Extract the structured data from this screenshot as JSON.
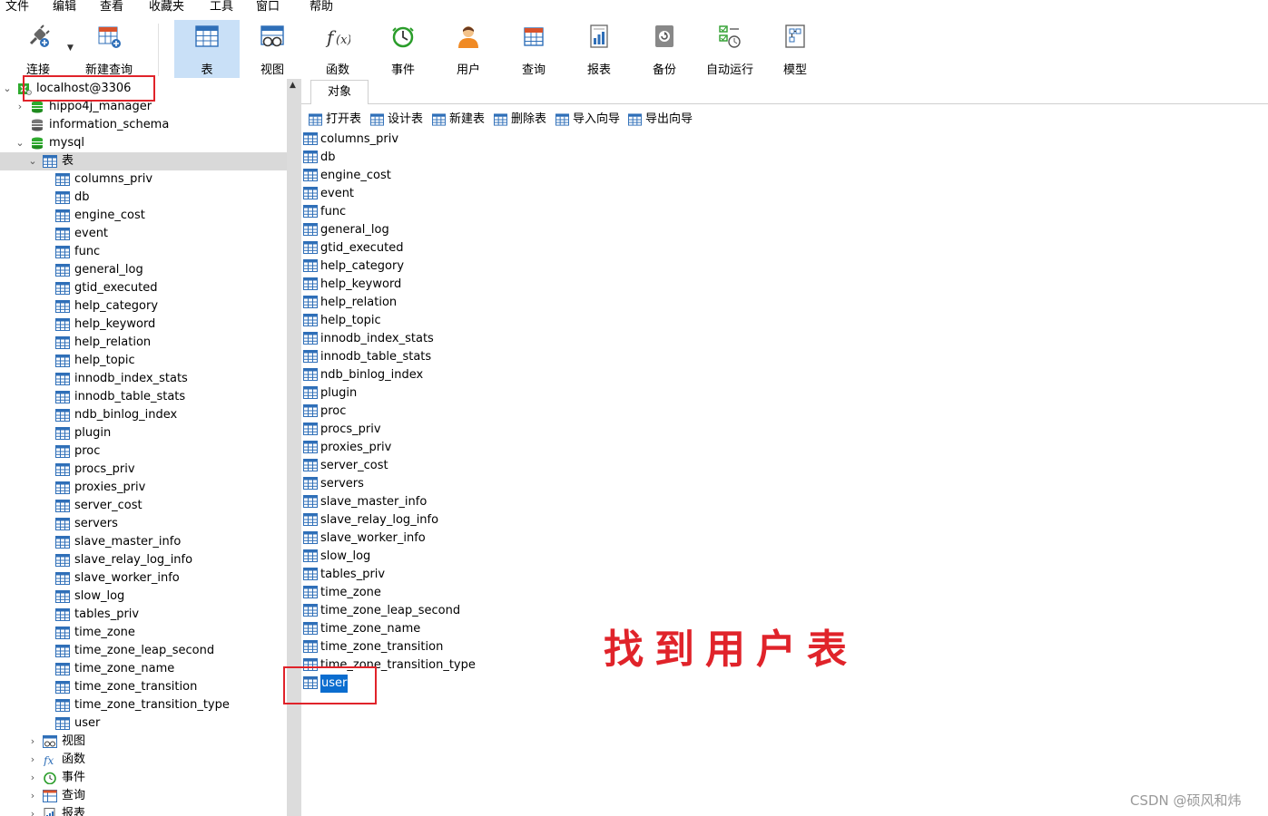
{
  "menu": [
    "文件",
    "编辑",
    "查看",
    "收藏夹",
    "工具",
    "窗口",
    "帮助"
  ],
  "toolbar": [
    {
      "label": "连接",
      "icon": "plug-icon"
    },
    {
      "label": "新建查询",
      "icon": "new-query-icon"
    },
    {
      "label": "表",
      "icon": "table-icon",
      "active": true
    },
    {
      "label": "视图",
      "icon": "view-icon"
    },
    {
      "label": "函数",
      "icon": "function-icon"
    },
    {
      "label": "事件",
      "icon": "clock-icon"
    },
    {
      "label": "用户",
      "icon": "user-icon"
    },
    {
      "label": "查询",
      "icon": "query-icon"
    },
    {
      "label": "报表",
      "icon": "report-icon"
    },
    {
      "label": "备份",
      "icon": "backup-icon"
    },
    {
      "label": "自动运行",
      "icon": "auto-run-icon"
    },
    {
      "label": "模型",
      "icon": "model-icon"
    }
  ],
  "tree": {
    "connection": "localhost@3306",
    "databases": [
      "hippo4j_manager",
      "information_schema",
      "mysql"
    ],
    "tables_node": "表",
    "tables": [
      "columns_priv",
      "db",
      "engine_cost",
      "event",
      "func",
      "general_log",
      "gtid_executed",
      "help_category",
      "help_keyword",
      "help_relation",
      "help_topic",
      "innodb_index_stats",
      "innodb_table_stats",
      "ndb_binlog_index",
      "plugin",
      "proc",
      "procs_priv",
      "proxies_priv",
      "server_cost",
      "servers",
      "slave_master_info",
      "slave_relay_log_info",
      "slave_worker_info",
      "slow_log",
      "tables_priv",
      "time_zone",
      "time_zone_leap_second",
      "time_zone_name",
      "time_zone_transition",
      "time_zone_transition_type",
      "user"
    ],
    "other_nodes": [
      "视图",
      "函数",
      "事件",
      "查询",
      "报表"
    ]
  },
  "main": {
    "tab": "对象",
    "actions": [
      "打开表",
      "设计表",
      "新建表",
      "删除表",
      "导入向导",
      "导出向导"
    ],
    "selected": "user"
  },
  "annotation": "找到用户表",
  "watermark": "CSDN @硕风和炜",
  "colors": {
    "highlight": "#0b6dcf",
    "redbox": "#e0232a",
    "active_tool": "#c9e0f7",
    "table_icon": "#2f6fb8"
  }
}
